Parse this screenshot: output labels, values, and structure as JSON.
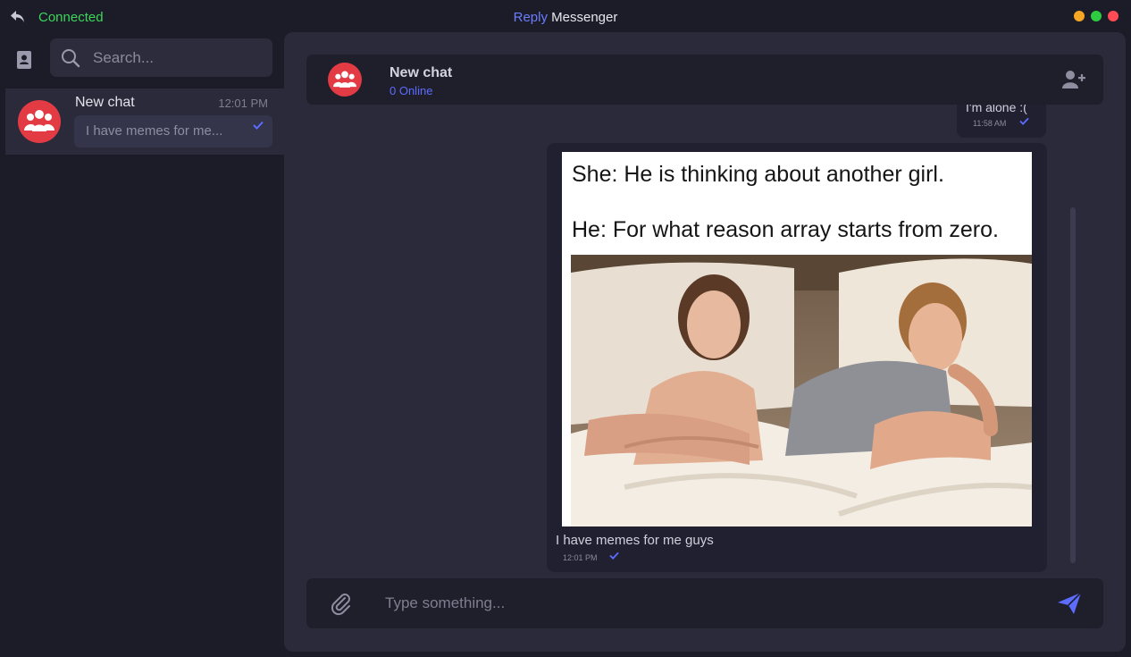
{
  "titlebar": {
    "connection_status": "Connected",
    "title_brand": "Reply",
    "title_rest": " Messenger",
    "window_controls": [
      "minimize",
      "maximize",
      "close"
    ],
    "colors": {
      "minimize": "#f5a623",
      "maximize": "#2ecc40",
      "close": "#ff4b55"
    }
  },
  "sidebar": {
    "search": {
      "placeholder": "Search...",
      "value": ""
    },
    "chats": [
      {
        "name": "New chat",
        "time": "12:01 PM",
        "preview": "I have memes for me...",
        "read": true
      }
    ]
  },
  "chat": {
    "header": {
      "name": "New chat",
      "online": "0 Online"
    },
    "messages": [
      {
        "text": "I'm alone :(",
        "time": "11:58 AM",
        "read": true
      },
      {
        "image_text_line1": "She: He is thinking about another girl.",
        "image_text_line2": "He: For what reason array starts from zero.",
        "caption": "I have memes for me guys",
        "time": "12:01 PM",
        "read": true
      }
    ],
    "composer": {
      "placeholder": "Type something...",
      "value": ""
    }
  },
  "colors": {
    "accent": "#5b6cff",
    "avatar": "#e23b44",
    "connected": "#3dd65a",
    "background": "#1c1c28",
    "panel": "#2a2a3a"
  },
  "icons": [
    "back-arrow-icon",
    "contacts-icon",
    "search-icon",
    "group-icon",
    "check-icon",
    "add-user-icon",
    "paperclip-icon",
    "send-icon"
  ]
}
